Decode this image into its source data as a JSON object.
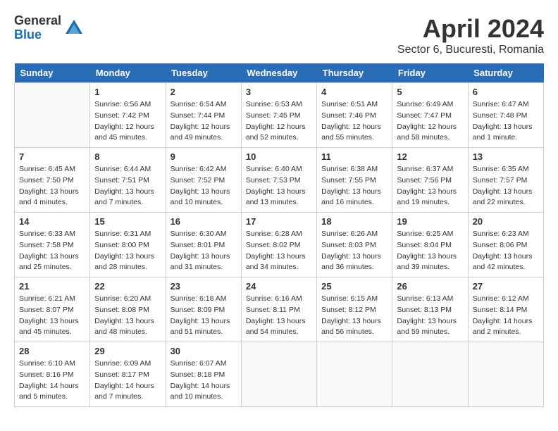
{
  "logo": {
    "general": "General",
    "blue": "Blue"
  },
  "title": "April 2024",
  "subtitle": "Sector 6, Bucuresti, Romania",
  "weekdays": [
    "Sunday",
    "Monday",
    "Tuesday",
    "Wednesday",
    "Thursday",
    "Friday",
    "Saturday"
  ],
  "weeks": [
    [
      {
        "day": "",
        "info": ""
      },
      {
        "day": "1",
        "info": "Sunrise: 6:56 AM\nSunset: 7:42 PM\nDaylight: 12 hours\nand 45 minutes."
      },
      {
        "day": "2",
        "info": "Sunrise: 6:54 AM\nSunset: 7:44 PM\nDaylight: 12 hours\nand 49 minutes."
      },
      {
        "day": "3",
        "info": "Sunrise: 6:53 AM\nSunset: 7:45 PM\nDaylight: 12 hours\nand 52 minutes."
      },
      {
        "day": "4",
        "info": "Sunrise: 6:51 AM\nSunset: 7:46 PM\nDaylight: 12 hours\nand 55 minutes."
      },
      {
        "day": "5",
        "info": "Sunrise: 6:49 AM\nSunset: 7:47 PM\nDaylight: 12 hours\nand 58 minutes."
      },
      {
        "day": "6",
        "info": "Sunrise: 6:47 AM\nSunset: 7:48 PM\nDaylight: 13 hours\nand 1 minute."
      }
    ],
    [
      {
        "day": "7",
        "info": ""
      },
      {
        "day": "8",
        "info": "Sunrise: 6:44 AM\nSunset: 7:51 PM\nDaylight: 13 hours\nand 7 minutes."
      },
      {
        "day": "9",
        "info": "Sunrise: 6:42 AM\nSunset: 7:52 PM\nDaylight: 13 hours\nand 10 minutes."
      },
      {
        "day": "10",
        "info": "Sunrise: 6:40 AM\nSunset: 7:53 PM\nDaylight: 13 hours\nand 13 minutes."
      },
      {
        "day": "11",
        "info": "Sunrise: 6:38 AM\nSunset: 7:55 PM\nDaylight: 13 hours\nand 16 minutes."
      },
      {
        "day": "12",
        "info": "Sunrise: 6:37 AM\nSunset: 7:56 PM\nDaylight: 13 hours\nand 19 minutes."
      },
      {
        "day": "13",
        "info": "Sunrise: 6:35 AM\nSunset: 7:57 PM\nDaylight: 13 hours\nand 22 minutes."
      }
    ],
    [
      {
        "day": "14",
        "info": ""
      },
      {
        "day": "15",
        "info": "Sunrise: 6:31 AM\nSunset: 8:00 PM\nDaylight: 13 hours\nand 28 minutes."
      },
      {
        "day": "16",
        "info": "Sunrise: 6:30 AM\nSunset: 8:01 PM\nDaylight: 13 hours\nand 31 minutes."
      },
      {
        "day": "17",
        "info": "Sunrise: 6:28 AM\nSunset: 8:02 PM\nDaylight: 13 hours\nand 34 minutes."
      },
      {
        "day": "18",
        "info": "Sunrise: 6:26 AM\nSunset: 8:03 PM\nDaylight: 13 hours\nand 36 minutes."
      },
      {
        "day": "19",
        "info": "Sunrise: 6:25 AM\nSunset: 8:04 PM\nDaylight: 13 hours\nand 39 minutes."
      },
      {
        "day": "20",
        "info": "Sunrise: 6:23 AM\nSunset: 8:06 PM\nDaylight: 13 hours\nand 42 minutes."
      }
    ],
    [
      {
        "day": "21",
        "info": "Sunrise: 6:21 AM\nSunset: 8:07 PM\nDaylight: 13 hours\nand 45 minutes."
      },
      {
        "day": "22",
        "info": "Sunrise: 6:20 AM\nSunset: 8:08 PM\nDaylight: 13 hours\nand 48 minutes."
      },
      {
        "day": "23",
        "info": "Sunrise: 6:18 AM\nSunset: 8:09 PM\nDaylight: 13 hours\nand 51 minutes."
      },
      {
        "day": "24",
        "info": "Sunrise: 6:16 AM\nSunset: 8:11 PM\nDaylight: 13 hours\nand 54 minutes."
      },
      {
        "day": "25",
        "info": "Sunrise: 6:15 AM\nSunset: 8:12 PM\nDaylight: 13 hours\nand 56 minutes."
      },
      {
        "day": "26",
        "info": "Sunrise: 6:13 AM\nSunset: 8:13 PM\nDaylight: 13 hours\nand 59 minutes."
      },
      {
        "day": "27",
        "info": "Sunrise: 6:12 AM\nSunset: 8:14 PM\nDaylight: 14 hours\nand 2 minutes."
      }
    ],
    [
      {
        "day": "28",
        "info": "Sunrise: 6:10 AM\nSunset: 8:16 PM\nDaylight: 14 hours\nand 5 minutes."
      },
      {
        "day": "29",
        "info": "Sunrise: 6:09 AM\nSunset: 8:17 PM\nDaylight: 14 hours\nand 7 minutes."
      },
      {
        "day": "30",
        "info": "Sunrise: 6:07 AM\nSunset: 8:18 PM\nDaylight: 14 hours\nand 10 minutes."
      },
      {
        "day": "",
        "info": ""
      },
      {
        "day": "",
        "info": ""
      },
      {
        "day": "",
        "info": ""
      },
      {
        "day": "",
        "info": ""
      }
    ]
  ],
  "week7_sunday_info": "Sunrise: 6:45 AM\nSunset: 7:50 PM\nDaylight: 13 hours\nand 4 minutes.",
  "week14_sunday_info": "Sunrise: 6:33 AM\nSunset: 7:58 PM\nDaylight: 13 hours\nand 25 minutes."
}
